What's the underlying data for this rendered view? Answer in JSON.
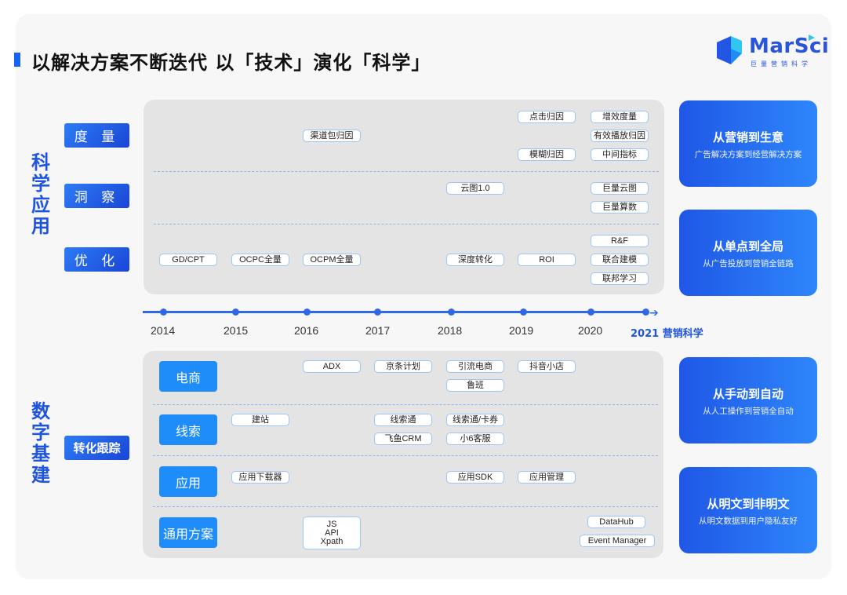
{
  "header": {
    "title": "以解决方案不断迭代 以「技术」演化「科学」",
    "logo": {
      "name": "MarSci",
      "subtitle": "巨量营销科学"
    }
  },
  "colors": {
    "accent": "#1f55de",
    "chip_border": "#9dc6f0",
    "panel_bg": "#e4e4e4",
    "row_button": "#1e8cf9"
  },
  "science": {
    "section_label": "科学应用",
    "categories": [
      {
        "label": "度 量"
      },
      {
        "label": "洞 察"
      },
      {
        "label": "优 化"
      }
    ],
    "chips": {
      "measure": [
        "渠道包归因",
        "点击归因",
        "模糊归因",
        "增效度量",
        "有效播放归因",
        "中间指标"
      ],
      "insight": [
        "云图1.0",
        "巨量云图",
        "巨量算数"
      ],
      "optimize": [
        "GD/CPT",
        "OCPC全量",
        "OCPM全量",
        "深度转化",
        "ROI",
        "R&F",
        "联合建模",
        "联邦学习"
      ]
    }
  },
  "timeline": {
    "years": [
      "2014",
      "2015",
      "2016",
      "2017",
      "2018",
      "2019",
      "2020"
    ],
    "final": "2021 营销科学"
  },
  "digital": {
    "section_label": "数字基建",
    "category": "转化跟踪",
    "rows": [
      {
        "label": "电商",
        "chips": [
          "ADX",
          "京条计划",
          "引流电商",
          "鲁班",
          "抖音小店"
        ]
      },
      {
        "label": "线索",
        "chips": [
          "建站",
          "线索通",
          "飞鱼CRM",
          "线索通/卡券",
          "小6客服"
        ]
      },
      {
        "label": "应用",
        "chips": [
          "应用下载器",
          "应用SDK",
          "应用管理"
        ]
      },
      {
        "label": "通用方案",
        "chips": [
          "JS",
          "API",
          "Xpath",
          "DataHub",
          "Event Manager"
        ]
      }
    ]
  },
  "side_cards": [
    {
      "title": "从营销到生意",
      "subtitle": "广告解决方案到经营解决方案"
    },
    {
      "title": "从单点到全局",
      "subtitle": "从广告投放到营销全链路"
    },
    {
      "title": "从手动到自动",
      "subtitle": "从人工操作到营销全自动"
    },
    {
      "title": "从明文到非明文",
      "subtitle": "从明文数据到用户隐私友好"
    }
  ]
}
